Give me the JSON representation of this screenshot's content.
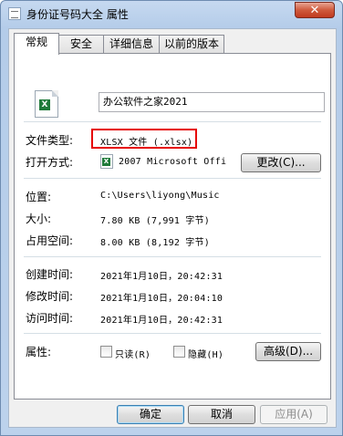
{
  "window": {
    "title": "身份证号码大全 属性",
    "close_glyph": "✕"
  },
  "tabs": [
    {
      "label": "常规"
    },
    {
      "label": "安全"
    },
    {
      "label": "详细信息"
    },
    {
      "label": "以前的版本"
    }
  ],
  "general": {
    "filename": "办公软件之家2021",
    "file_type": {
      "label": "文件类型:",
      "value": "XLSX 文件 (.xlsx)"
    },
    "open_with": {
      "label": "打开方式:",
      "value": "2007 Microsoft Offi",
      "change_button": "更改(C)..."
    },
    "location": {
      "label": "位置:",
      "value": "C:\\Users\\liyong\\Music"
    },
    "size": {
      "label": "大小:",
      "value": "7.80 KB (7,991 字节)"
    },
    "size_on_disk": {
      "label": "占用空间:",
      "value": "8.00 KB (8,192 字节)"
    },
    "created": {
      "label": "创建时间:",
      "value": "2021年1月10日，20:42:31"
    },
    "modified": {
      "label": "修改时间:",
      "value": "2021年1月10日，20:04:10"
    },
    "accessed": {
      "label": "访问时间:",
      "value": "2021年1月10日，20:42:31"
    },
    "attributes": {
      "label": "属性:",
      "readonly": "只读(R)",
      "hidden": "隐藏(H)",
      "advanced_button": "高级(D)..."
    }
  },
  "footer": {
    "ok": "确定",
    "cancel": "取消",
    "apply": "应用(A)"
  },
  "colors": {
    "highlight_box": "#e60000",
    "excel_green": "#1f7a3a"
  }
}
